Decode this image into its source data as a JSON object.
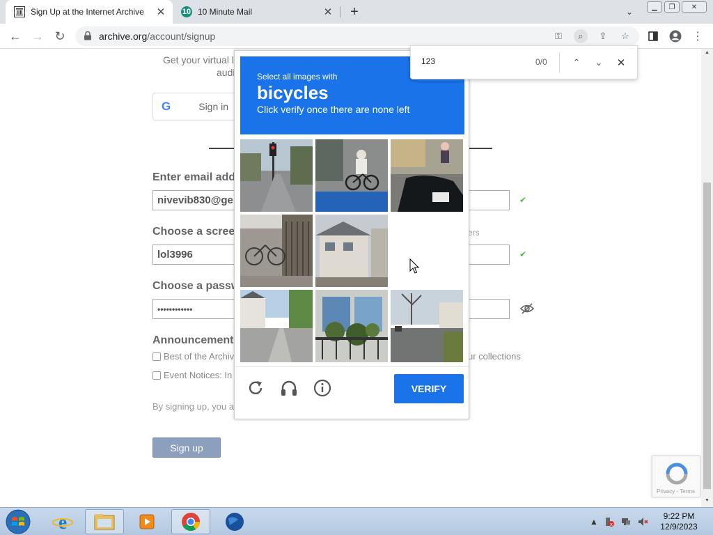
{
  "browser": {
    "tabs": [
      {
        "title": "Sign Up at the Internet Archive",
        "icon": "internet-archive-icon",
        "active": true
      },
      {
        "title": "10 Minute Mail",
        "icon": "10-minute-mail-icon",
        "active": false
      }
    ],
    "url_host": "archive.org",
    "url_path": "/account/signup"
  },
  "page": {
    "intro_line1": "Get your virtual l",
    "intro_line2": "audi",
    "google_button": "Sign in",
    "email_label": "Enter email add",
    "email_value": "nivevib830@ge",
    "screenname_label": "Choose a scree",
    "screenname_value": "lol3996",
    "screenname_hint": "ers",
    "password_label": "Choose a passw",
    "password_value": "••••••••••••",
    "announcements_label": "Announcement",
    "checkbox1_label": "Best of the Archiv",
    "checkbox1_tail": "ur collections",
    "checkbox2_label": "Event Notices: In",
    "legal_text": "By signing up, you a",
    "signup_button": "Sign up",
    "recaptcha_terms": "Privacy - Terms"
  },
  "captcha": {
    "instruction": "Select all images with",
    "target": "bicycles",
    "subtext": "Click verify once there are none left",
    "verify_label": "VERIFY",
    "tiles": [
      "street-with-traffic-light",
      "person-on-bicycle",
      "car-rear",
      "bicycle-at-gate",
      "house",
      "blank",
      "street-with-houses",
      "balcony-plants",
      "tree-lined-street"
    ]
  },
  "findbar": {
    "query": "123",
    "count": "0/0"
  },
  "taskbar": {
    "time": "9:22 PM",
    "date": "12/9/2023"
  }
}
